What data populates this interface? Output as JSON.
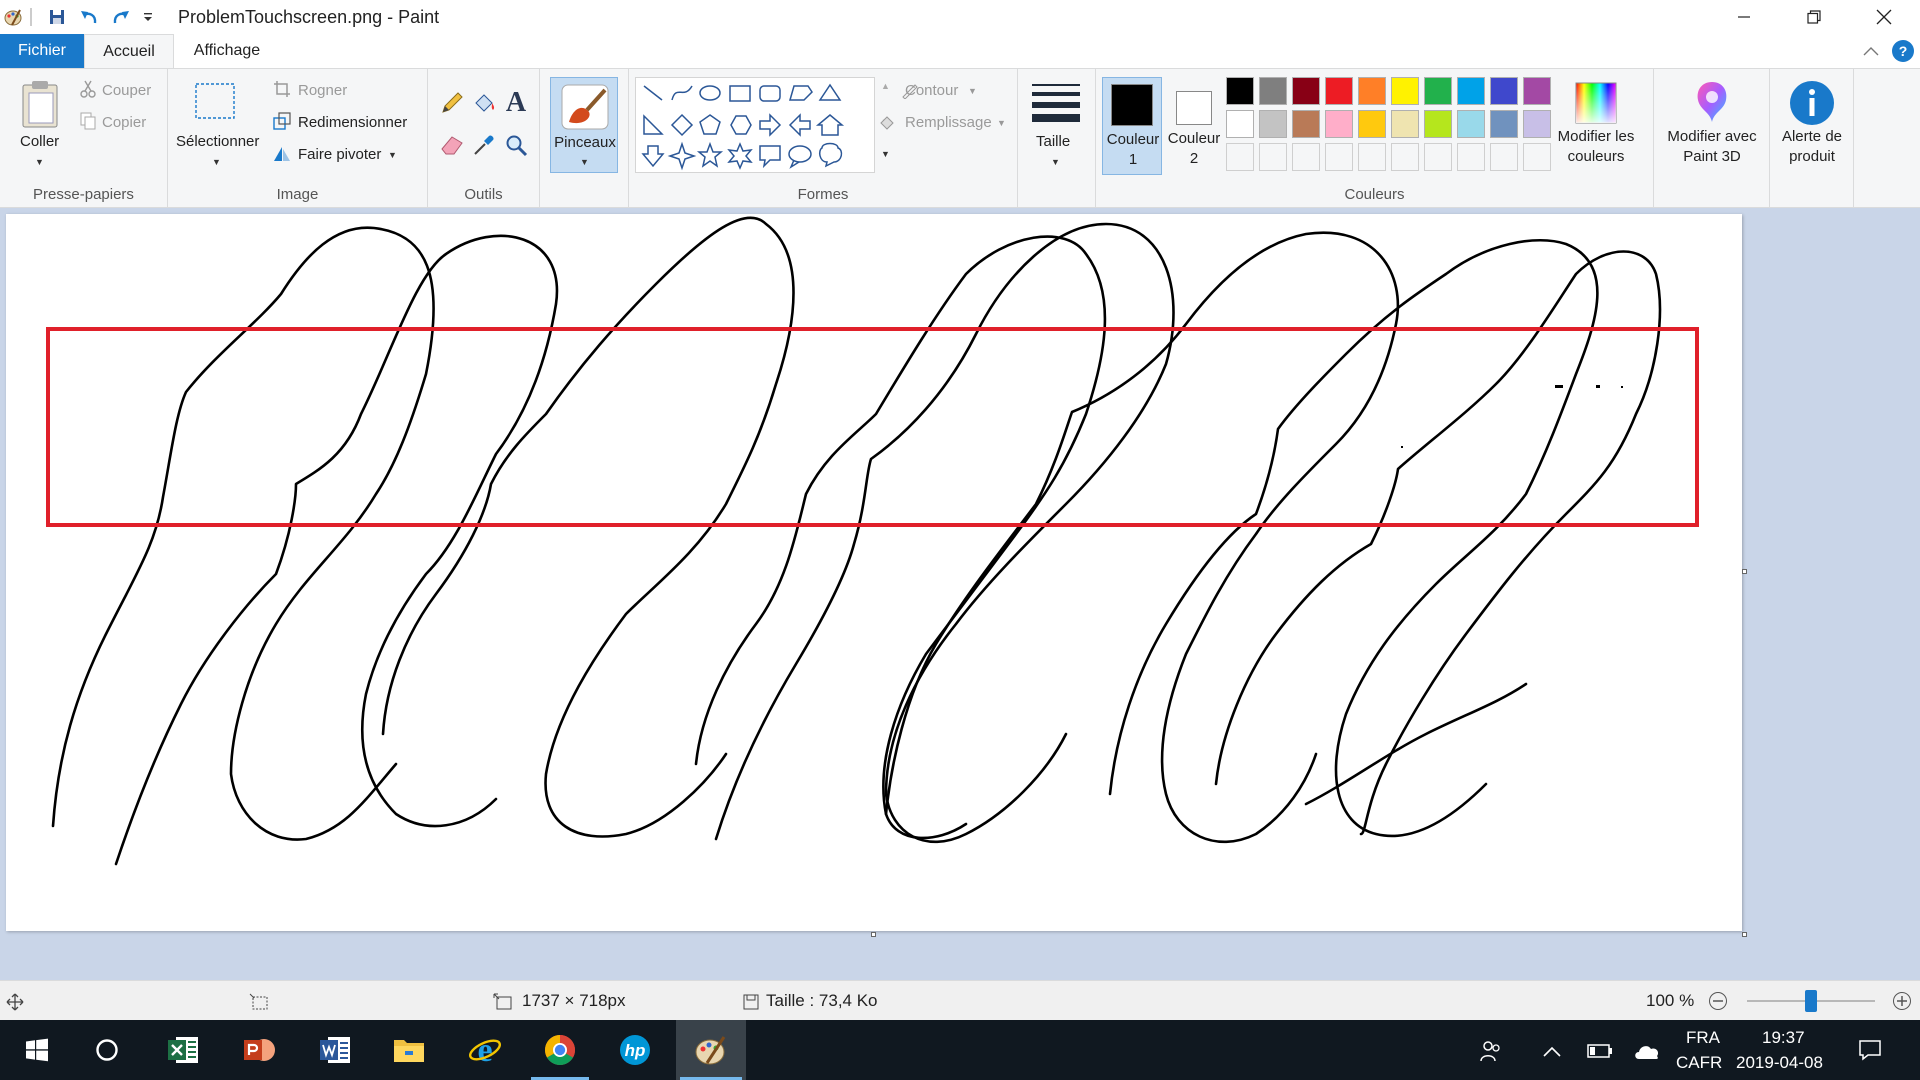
{
  "window": {
    "title": "ProblemTouchscreen.png - Paint"
  },
  "tabs": {
    "file": "Fichier",
    "home": "Accueil",
    "view": "Affichage"
  },
  "ribbon": {
    "clipboard": {
      "group_label": "Presse-papiers",
      "paste": "Coller",
      "cut": "Couper",
      "copy": "Copier"
    },
    "image": {
      "group_label": "Image",
      "select": "Sélectionner",
      "crop": "Rogner",
      "resize": "Redimensionner",
      "rotate": "Faire pivoter"
    },
    "tools": {
      "group_label": "Outils"
    },
    "brushes": {
      "label": "Pinceaux"
    },
    "shapes": {
      "group_label": "Formes",
      "outline": "Contour",
      "fill": "Remplissage"
    },
    "size": {
      "label": "Taille"
    },
    "colors": {
      "group_label": "Couleurs",
      "color1": "Couleur 1",
      "color2": "Couleur 2",
      "edit_colors": "Modifier les couleurs",
      "color1_value": "#000000",
      "color2_value": "#ffffff",
      "palette_row1": [
        "#000000",
        "#7f7f7f",
        "#880015",
        "#ed1c24",
        "#ff7f27",
        "#fff200",
        "#22b14c",
        "#00a2e8",
        "#3f48cc",
        "#a349a4"
      ],
      "palette_row2": [
        "#ffffff",
        "#c3c3c3",
        "#b97a57",
        "#ffaec9",
        "#ffc90e",
        "#efe4b0",
        "#b5e61d",
        "#99d9ea",
        "#7092be",
        "#c8bfe7"
      ]
    },
    "paint3d": {
      "label": "Modifier avec Paint 3D"
    },
    "product_alert": {
      "label": "Alerte de produit"
    }
  },
  "statusbar": {
    "dimensions": "1737 × 718px",
    "file_size": "Taille : 73,4 Ko",
    "zoom": "100 %",
    "zoom_percent": 100
  },
  "taskbar": {
    "language": "FRA",
    "layout": "CAFR",
    "time": "19:37",
    "date": "2019-04-08"
  },
  "accent_colors": {
    "file_tab": "#1979ca",
    "highlight_box": "#e0202a"
  }
}
